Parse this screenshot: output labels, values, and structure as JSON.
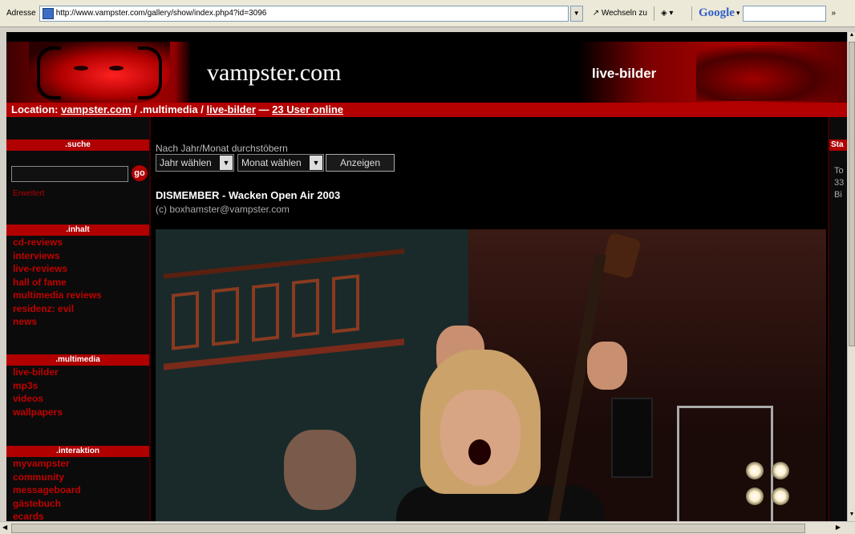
{
  "browser": {
    "address_label": "Adresse",
    "url": "http://www.vampster.com/gallery/show/index.php4?id=3096",
    "go_label": "Wechseln zu",
    "google_label": "Google"
  },
  "header": {
    "site_title": "vampster.com",
    "section_title": "live-bilder"
  },
  "location": {
    "prefix": "Location:",
    "home": "vampster.com",
    "sep1": " / ",
    "crumb2": ".multimedia",
    "sep2": " / ",
    "crumb3": "live-bilder",
    "sep3": " — ",
    "online": "23 User online"
  },
  "sidebar": {
    "search_title": ".suche",
    "search_button": "go",
    "advanced_link": "Erweitert",
    "content_title": ".inhalt",
    "content_items": [
      "cd-reviews",
      "interviews",
      "live-reviews",
      "hall of fame",
      "multimedia reviews",
      "residenz: evil",
      "news"
    ],
    "multimedia_title": ".multimedia",
    "multimedia_items": [
      "live-bilder",
      "mp3s",
      "videos",
      "wallpapers"
    ],
    "interaction_title": ".interaktion",
    "interaction_items": [
      "myvampster",
      "community",
      "messageboard",
      "gästebuch",
      "ecards"
    ]
  },
  "main": {
    "browse_label": "Nach Jahr/Monat durchstöbern",
    "year_select": "Jahr wählen",
    "month_select": "Monat wählen",
    "show_button": "Anzeigen",
    "gallery_title": "DISMEMBER - Wacken Open Air 2003",
    "gallery_credit": "(c) boxhamster@vampster.com"
  },
  "right": {
    "title": "Sta",
    "lines": [
      "To",
      "33",
      "Bi"
    ]
  }
}
